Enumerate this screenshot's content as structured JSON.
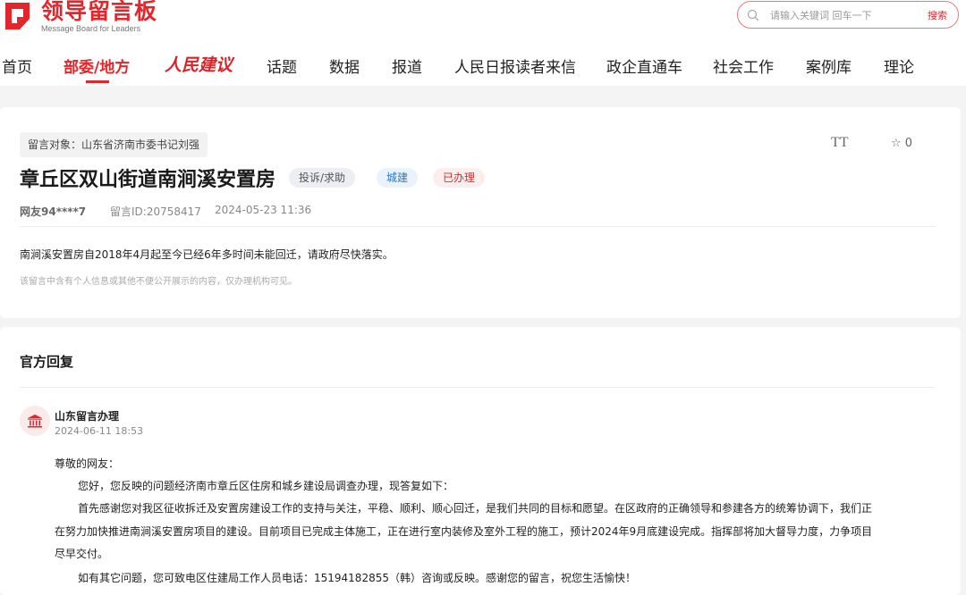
{
  "header": {
    "logo_title": "领导留言板",
    "logo_subtitle": "Message Board for Leaders",
    "search_placeholder": "请输入关键词 回车一下",
    "search_button": "搜索"
  },
  "nav": {
    "items": [
      "首页",
      "部委/地方",
      "话题",
      "数据",
      "报道",
      "人民日报读者来信",
      "政企直通车",
      "社会工作",
      "案例库",
      "理论"
    ],
    "brand_item": "人民建议",
    "active_index": 1
  },
  "message": {
    "target": "留言对象：山东省济南市委书记刘强",
    "font_toggle": "TT",
    "favorites_count": "0",
    "title": "章丘区双山街道南涧溪安置房",
    "badges": {
      "type": "投诉/求助",
      "category": "城建",
      "status": "已办理"
    },
    "user": "网友94****7",
    "message_id": "留言ID:20758417",
    "time": "2024-05-23 11:36",
    "content": "南涧溪安置房自2018年4月起至今已经6年多时间未能回迁，请政府尽快落实。",
    "privacy_note": "该留言中含有个人信息或其他不便公开展示的内容，仅办理机构可见。"
  },
  "reply": {
    "heading": "官方回复",
    "org": "山东留言办理",
    "time": "2024-06-11 18:53",
    "greeting": "尊敬的网友：",
    "p1": "您好，您反映的问题经济南市章丘区住房和城乡建设局调查办理，现答复如下：",
    "p2_line1": "首先感谢您对我区征收拆迁及安置房建设工作的支持与关注，平稳、顺利、顺心回迁，是我们共同的目标和愿望。在区政府的正确领导和参建各方的统筹协调下，我们正",
    "p2_line2": "在努力加快推进南涧溪安置房项目的建设。目前项目已完成主体施工，正在进行室内装修及室外工程的施工，预计2024年9月底建设完成。指挥部将加大督导力度，力争项目",
    "p2_line3": "尽早交付。",
    "p3": "如有其它问题，您可致电区住建局工作人员电话：15194182855（韩）咨询或反映。感谢您的留言，祝您生活愉快！"
  },
  "colors": {
    "brand_red": "#e3262b",
    "badge_blue": "#2b79c9",
    "page_bg": "#f4f4f5"
  },
  "icons": [
    "logo-mark-icon",
    "search-icon",
    "font-size-icon",
    "star-icon",
    "bank-icon"
  ]
}
